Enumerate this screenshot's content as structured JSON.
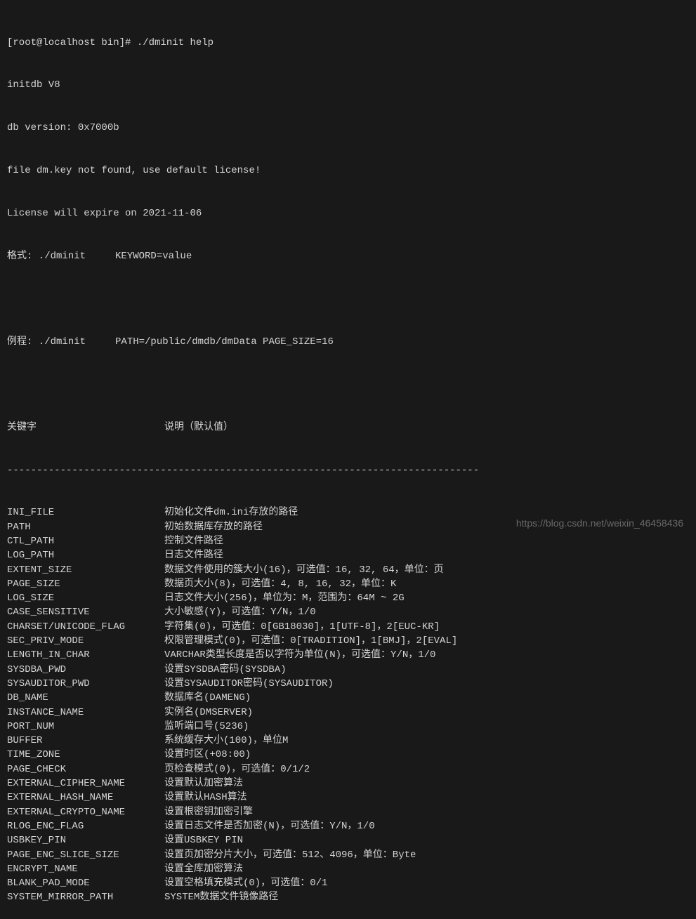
{
  "header": {
    "prompt": "[root@localhost bin]# ./dminit help",
    "initdb": "initdb V8",
    "db_version": "db version: 0x7000b",
    "license_warn": "file dm.key not found, use default license!",
    "license_expire": "License will expire on 2021-11-06",
    "format_label": "格式: ./dminit     KEYWORD=value",
    "example_label": "例程: ./dminit     PATH=/public/dmdb/dmData PAGE_SIZE=16"
  },
  "table_header": {
    "keyword": "关键字",
    "description": "说明（默认值）"
  },
  "separator": "--------------------------------------------------------------------------------",
  "rows": [
    {
      "key": "INI_FILE",
      "desc": "初始化文件dm.ini存放的路径"
    },
    {
      "key": "PATH",
      "desc": "初始数据库存放的路径"
    },
    {
      "key": "CTL_PATH",
      "desc": "控制文件路径"
    },
    {
      "key": "LOG_PATH",
      "desc": "日志文件路径"
    },
    {
      "key": "EXTENT_SIZE",
      "desc": "数据文件使用的簇大小(16)，可选值：16, 32, 64，单位：页"
    },
    {
      "key": "PAGE_SIZE",
      "desc": "数据页大小(8)，可选值：4, 8, 16, 32，单位：K"
    },
    {
      "key": "LOG_SIZE",
      "desc": "日志文件大小(256)，单位为：M，范围为：64M ~ 2G"
    },
    {
      "key": "CASE_SENSITIVE",
      "desc": "大小敏感(Y)，可选值：Y/N，1/0"
    },
    {
      "key": "CHARSET/UNICODE_FLAG",
      "desc": "字符集(0)，可选值：0[GB18030]，1[UTF-8]，2[EUC-KR]"
    },
    {
      "key": "SEC_PRIV_MODE",
      "desc": "权限管理模式(0)，可选值：0[TRADITION]，1[BMJ]，2[EVAL]"
    },
    {
      "key": "LENGTH_IN_CHAR",
      "desc": "VARCHAR类型长度是否以字符为单位(N)，可选值：Y/N，1/0"
    },
    {
      "key": "SYSDBA_PWD",
      "desc": "设置SYSDBA密码(SYSDBA)"
    },
    {
      "key": "SYSAUDITOR_PWD",
      "desc": "设置SYSAUDITOR密码(SYSAUDITOR)"
    },
    {
      "key": "DB_NAME",
      "desc": "数据库名(DAMENG)"
    },
    {
      "key": "INSTANCE_NAME",
      "desc": "实例名(DMSERVER)"
    },
    {
      "key": "PORT_NUM",
      "desc": "监听端口号(5236)"
    },
    {
      "key": "BUFFER",
      "desc": "系统缓存大小(100)，单位M"
    },
    {
      "key": "TIME_ZONE",
      "desc": "设置时区(+08:00)"
    },
    {
      "key": "PAGE_CHECK",
      "desc": "页检查模式(0)，可选值：0/1/2"
    },
    {
      "key": "EXTERNAL_CIPHER_NAME",
      "desc": "设置默认加密算法"
    },
    {
      "key": "EXTERNAL_HASH_NAME",
      "desc": "设置默认HASH算法"
    },
    {
      "key": "EXTERNAL_CRYPTO_NAME",
      "desc": "设置根密钥加密引擎"
    },
    {
      "key": "RLOG_ENC_FLAG",
      "desc": "设置日志文件是否加密(N)，可选值：Y/N，1/0"
    },
    {
      "key": "USBKEY_PIN",
      "desc": "设置USBKEY PIN"
    },
    {
      "key": "PAGE_ENC_SLICE_SIZE",
      "desc": "设置页加密分片大小，可选值：512、4096，单位：Byte"
    },
    {
      "key": "ENCRYPT_NAME",
      "desc": "设置全库加密算法"
    },
    {
      "key": "BLANK_PAD_MODE",
      "desc": "设置空格填充模式(0)，可选值：0/1"
    },
    {
      "key": "SYSTEM_MIRROR_PATH",
      "desc": "SYSTEM数据文件镜像路径"
    }
  ],
  "watermark": "https://blog.csdn.net/weixin_46458436"
}
